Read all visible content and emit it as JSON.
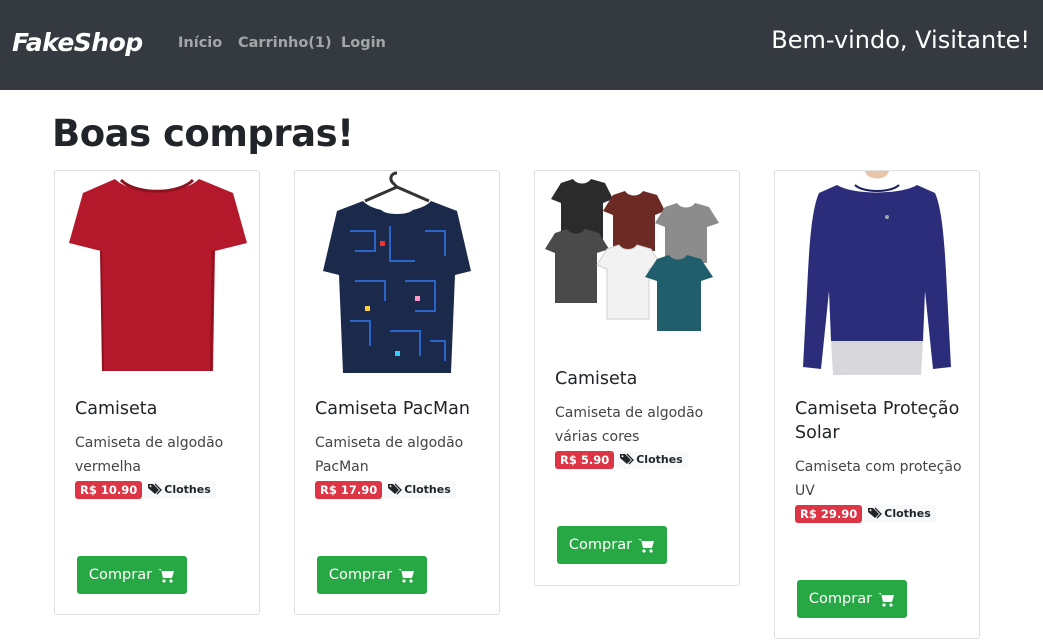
{
  "navbar": {
    "brand": "FakeShop",
    "links": [
      "Início",
      "Carrinho(1)",
      "Login"
    ],
    "welcome": "Bem-vindo, Visitante!"
  },
  "page": {
    "title": "Boas compras!"
  },
  "products": [
    {
      "title": "Camiseta",
      "description": "Camiseta de algodão vermelha",
      "price": "R$ 10.90",
      "category": "Clothes",
      "button": "Comprar",
      "image": "red-tshirt"
    },
    {
      "title": "Camiseta PacMan",
      "description": "Camiseta de algodão PacMan",
      "price": "R$ 17.90",
      "category": "Clothes",
      "button": "Comprar",
      "image": "pacman-tshirt-on-hanger"
    },
    {
      "title": "Camiseta",
      "description": "Camiseta de algodão várias cores",
      "price": "R$ 5.90",
      "category": "Clothes",
      "button": "Comprar",
      "image": "multicolor-tshirts"
    },
    {
      "title": "Camiseta Proteção Solar",
      "description": "Camiseta com proteção UV",
      "price": "R$ 29.90",
      "category": "Clothes",
      "button": "Comprar",
      "image": "navy-longsleeve-shirt"
    }
  ],
  "colors": {
    "navbar": "#343a40",
    "price_badge": "#dc3545",
    "buy_button": "#28a745"
  }
}
